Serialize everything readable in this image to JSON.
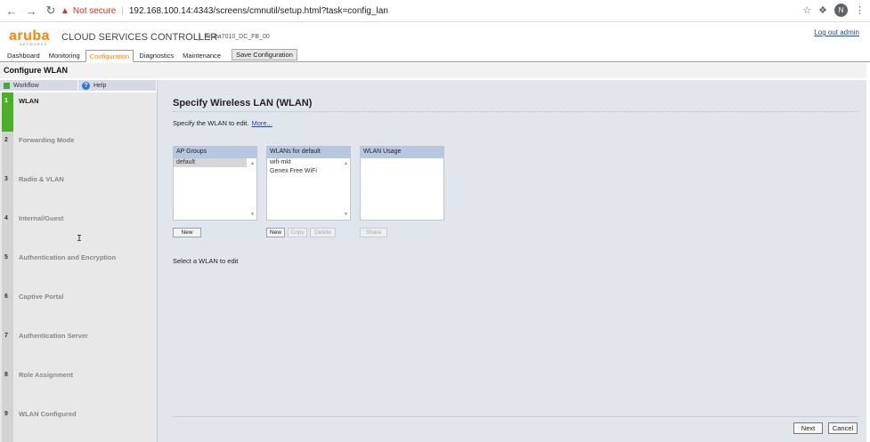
{
  "browser": {
    "not_secure": "Not secure",
    "url": "192.168.100.14:4343/screens/cmnutil/setup.html?task=config_lan",
    "profile_initial": "N"
  },
  "header": {
    "logo": "aruba",
    "logo_sub": "NETWORKS",
    "product": "CLOUD SERVICES CONTROLLER",
    "hostname": "Aruba7010_DC_FB_00",
    "logout": "Log out admin"
  },
  "tabs": [
    {
      "label": "Dashboard",
      "active": false
    },
    {
      "label": "Monitoring",
      "active": false
    },
    {
      "label": "Configuration",
      "active": true
    },
    {
      "label": "Diagnostics",
      "active": false
    },
    {
      "label": "Maintenance",
      "active": false
    }
  ],
  "save_configuration": "Save Configuration",
  "page_title": "Configure WLAN",
  "workflow": {
    "workflow_tab": "Workflow",
    "help_tab": "Help",
    "steps": [
      {
        "num": "1",
        "label": "WLAN",
        "active": true
      },
      {
        "num": "2",
        "label": "Forwarding Mode",
        "active": false
      },
      {
        "num": "3",
        "label": "Radio & VLAN",
        "active": false
      },
      {
        "num": "4",
        "label": "Internal/Guest",
        "active": false
      },
      {
        "num": "5",
        "label": "Authentication and Encryption",
        "active": false
      },
      {
        "num": "6",
        "label": "Captive Portal",
        "active": false
      },
      {
        "num": "7",
        "label": "Authentication Server",
        "active": false
      },
      {
        "num": "8",
        "label": "Role Assignment",
        "active": false
      },
      {
        "num": "9",
        "label": "WLAN Configured",
        "active": false
      }
    ]
  },
  "main": {
    "title": "Specify Wireless LAN (WLAN)",
    "description": "Specify the WLAN to edit.",
    "more_link": "More...",
    "ap_groups": {
      "header": "AP Groups",
      "items": [
        "default"
      ],
      "selected": "default"
    },
    "wlans": {
      "header": "WLANs for default",
      "items": [
        "wifi-mkt",
        "Genex Free WiFi"
      ]
    },
    "wlan_usage": {
      "header": "WLAN Usage",
      "items": []
    },
    "buttons": {
      "new_group": "New",
      "new_wlan": "New",
      "copy": "Copy",
      "delete": "Delete",
      "share": "Share"
    },
    "hint": "Select a WLAN to edit",
    "next": "Next",
    "cancel": "Cancel"
  },
  "colors": {
    "brand": "#ff8300",
    "active_step": "#4caf28",
    "list_header": "#b6c7e2",
    "link": "#1a4ea0"
  }
}
